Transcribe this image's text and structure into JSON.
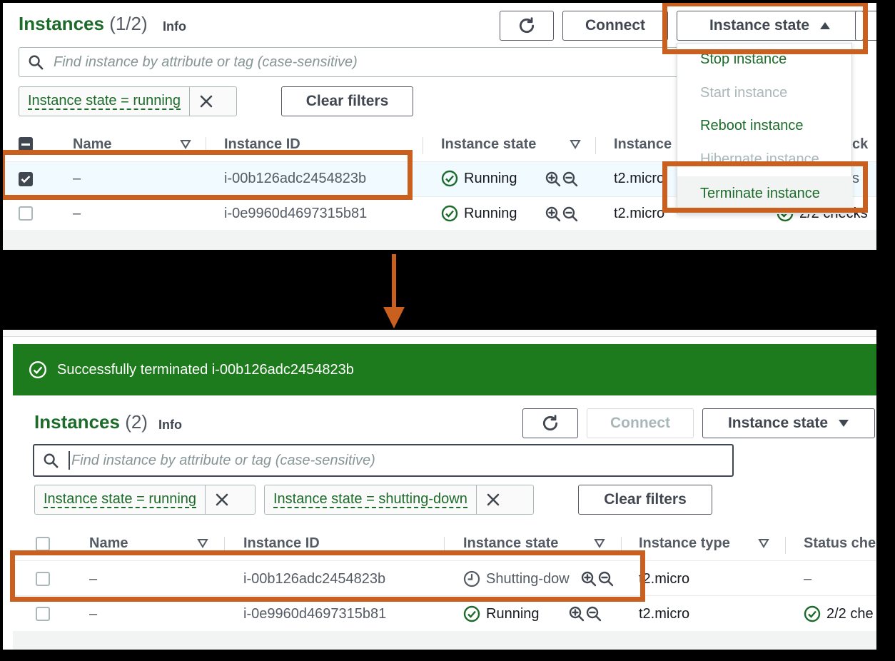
{
  "top": {
    "title": "Instances",
    "count": "(1/2)",
    "info": "Info",
    "connect_label": "Connect",
    "instance_state_label": "Instance state",
    "search_placeholder": "Find instance by attribute or tag (case-sensitive)",
    "filters": [
      "Instance state = running"
    ],
    "clear_filters_label": "Clear filters",
    "columns": [
      "Name",
      "Instance ID",
      "Instance state",
      "Instance",
      "ck"
    ],
    "rows": [
      {
        "name": "–",
        "id": "i-00b126adc2454823b",
        "state": "Running",
        "type": "t2.micro",
        "status": "cks",
        "checked": true
      },
      {
        "name": "–",
        "id": "i-0e9960d4697315b81",
        "state": "Running",
        "type": "t2.micro",
        "status": "2/2 checks",
        "checked": false
      }
    ],
    "menu": {
      "items": [
        {
          "label": "Stop instance",
          "enabled": true
        },
        {
          "label": "Start instance",
          "enabled": false
        },
        {
          "label": "Reboot instance",
          "enabled": true
        },
        {
          "label": "Hibernate instance",
          "enabled": false
        },
        {
          "label": "Terminate instance",
          "enabled": true
        }
      ]
    }
  },
  "bottom": {
    "banner_text": "Successfully terminated i-00b126adc2454823b",
    "title": "Instances",
    "count": "(2)",
    "info": "Info",
    "connect_label": "Connect",
    "instance_state_label": "Instance state",
    "search_placeholder": "Find instance by attribute or tag (case-sensitive)",
    "filters": [
      "Instance state = running",
      "Instance state = shutting-down"
    ],
    "clear_filters_label": "Clear filters",
    "columns": [
      "Name",
      "Instance ID",
      "Instance state",
      "Instance type",
      "Status che"
    ],
    "rows": [
      {
        "name": "–",
        "id": "i-00b126adc2454823b",
        "state": "Shutting-dow",
        "type": "t2.micro",
        "status": "–"
      },
      {
        "name": "–",
        "id": "i-0e9960d4697315b81",
        "state": "Running",
        "type": "t2.micro",
        "status": "2/2 che"
      }
    ]
  },
  "colors": {
    "highlight": "#c9601f",
    "brand_green": "#1d6b2a",
    "banner_green": "#1d7a1d"
  },
  "icons": {
    "refresh": "refresh-icon",
    "search": "search-icon",
    "close": "close-icon",
    "caret_up": "caret-up-icon",
    "caret_down": "caret-down-icon",
    "sort": "sort-icon",
    "status_ok": "check-circle-icon",
    "pending": "clock-icon",
    "zoom_in": "zoom-in-icon",
    "zoom_out": "zoom-out-icon",
    "arrow": "arrow-down-icon"
  }
}
